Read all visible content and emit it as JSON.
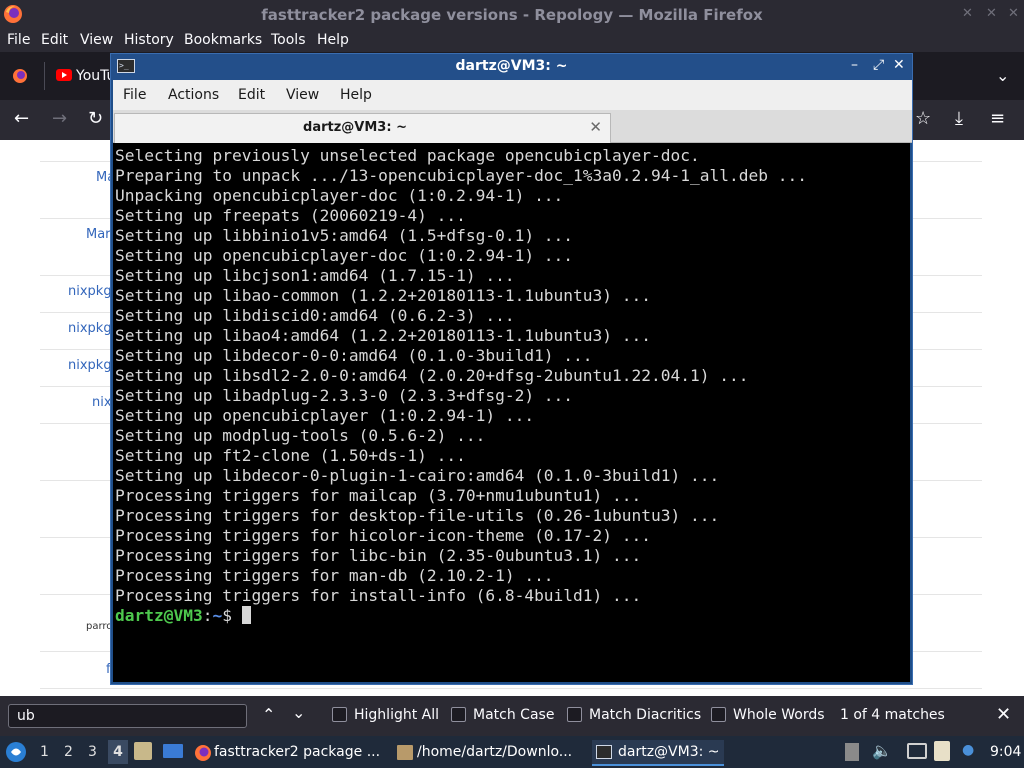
{
  "firefox": {
    "window_title": "fasttracker2 package versions - Repology — Mozilla Firefox",
    "menu": [
      "File",
      "Edit",
      "View",
      "History",
      "Bookmarks",
      "Tools",
      "Help"
    ],
    "tab_label": "YouTu",
    "page_links": [
      "Ma",
      "Mar",
      "nixpkgs",
      "nixpkgs",
      "nixpkgs",
      "nix",
      "parro",
      "f"
    ]
  },
  "findbar": {
    "query": "ub",
    "highlight_all": "Highlight All",
    "match_case": "Match Case",
    "match_diacritics": "Match Diacritics",
    "whole_words": "Whole Words",
    "status": "1 of 4 matches"
  },
  "terminal": {
    "window_title": "dartz@VM3: ~",
    "menu": [
      "File",
      "Actions",
      "Edit",
      "View",
      "Help"
    ],
    "tab_title": "dartz@VM3: ~",
    "lines": [
      "Selecting previously unselected package opencubicplayer-doc.",
      "Preparing to unpack .../13-opencubicplayer-doc_1%3a0.2.94-1_all.deb ...",
      "Unpacking opencubicplayer-doc (1:0.2.94-1) ...",
      "Setting up freepats (20060219-4) ...",
      "Setting up libbinio1v5:amd64 (1.5+dfsg-0.1) ...",
      "Setting up opencubicplayer-doc (1:0.2.94-1) ...",
      "Setting up libcjson1:amd64 (1.7.15-1) ...",
      "Setting up libao-common (1.2.2+20180113-1.1ubuntu3) ...",
      "Setting up libdiscid0:amd64 (0.6.2-3) ...",
      "Setting up libao4:amd64 (1.2.2+20180113-1.1ubuntu3) ...",
      "Setting up libdecor-0-0:amd64 (0.1.0-3build1) ...",
      "Setting up libsdl2-2.0-0:amd64 (2.0.20+dfsg-2ubuntu1.22.04.1) ...",
      "Setting up libadplug-2.3.3-0 (2.3.3+dfsg-2) ...",
      "Setting up opencubicplayer (1:0.2.94-1) ...",
      "Setting up modplug-tools (0.5.6-2) ...",
      "Setting up ft2-clone (1.50+ds-1) ...",
      "Setting up libdecor-0-plugin-1-cairo:amd64 (0.1.0-3build1) ...",
      "Processing triggers for mailcap (3.70+nmu1ubuntu1) ...",
      "Processing triggers for desktop-file-utils (0.26-1ubuntu3) ...",
      "Processing triggers for hicolor-icon-theme (0.17-2) ...",
      "Processing triggers for libc-bin (2.35-0ubuntu3.1) ...",
      "Processing triggers for man-db (2.10.2-1) ...",
      "Processing triggers for install-info (6.8-4build1) ..."
    ],
    "prompt_user": "dartz@VM3",
    "prompt_sep": ":",
    "prompt_path": "~",
    "prompt_symbol": "$ "
  },
  "taskbar": {
    "workspaces": [
      "1",
      "2",
      "3",
      "4"
    ],
    "active_workspace": "4",
    "tasks": [
      {
        "label": "fasttracker2 package ...",
        "icon": "firefox-icon"
      },
      {
        "label": "/home/dartz/Downlo...",
        "icon": "folder-icon"
      },
      {
        "label": "dartz@VM3: ~",
        "icon": "terminal-icon"
      }
    ],
    "clock": "9:04"
  }
}
